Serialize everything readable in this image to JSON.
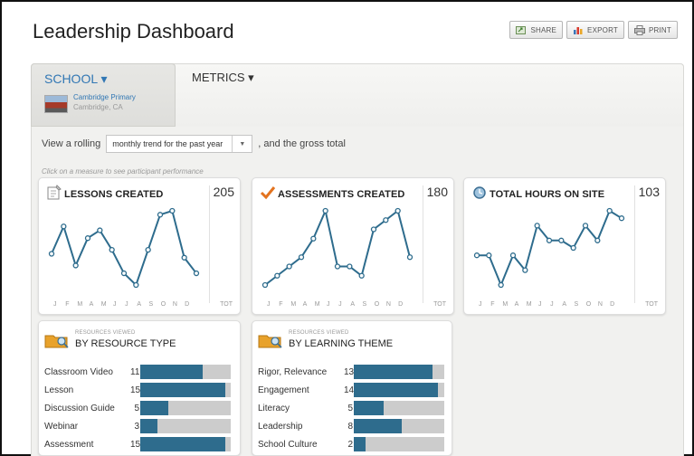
{
  "page": {
    "title": "Leadership Dashboard"
  },
  "actions": [
    {
      "label": "SHARE",
      "icon": "share-icon"
    },
    {
      "label": "EXPORT",
      "icon": "export-icon"
    },
    {
      "label": "PRINT",
      "icon": "print-icon"
    }
  ],
  "school": {
    "label": "SCHOOL ▾",
    "name": "Cambridge Primary",
    "location": "Cambridge, CA"
  },
  "metrics": {
    "label": "METRICS ▾"
  },
  "rolling": {
    "prefix": "View a rolling",
    "select_value": "monthly trend for the past year",
    "suffix": ", and the gross total"
  },
  "hint": "Click on a measure to see participant performance",
  "accent": "#2e6c8d",
  "months": [
    "J",
    "F",
    "M",
    "A",
    "M",
    "J",
    "J",
    "A",
    "S",
    "O",
    "N",
    "D"
  ],
  "tot_label": "TOT",
  "cards": [
    {
      "title": "LESSONS CREATED",
      "total": "205",
      "icon": "lessons-icon",
      "values": [
        9,
        16,
        6,
        13,
        15,
        10,
        4,
        1,
        10,
        19,
        20,
        8,
        4
      ]
    },
    {
      "title": "ASSESSMENTS CREATED",
      "total": "180",
      "icon": "checkmark-icon",
      "values": [
        5,
        6,
        7,
        8,
        10,
        13,
        7,
        7,
        6,
        11,
        12,
        13,
        8
      ]
    },
    {
      "title": "TOTAL HOURS ON SITE",
      "total": "103",
      "icon": "clock-icon",
      "values": [
        7,
        7,
        5,
        7,
        6,
        9,
        8,
        8,
        7.5,
        9,
        8,
        10,
        9.5
      ]
    }
  ],
  "resources_type": {
    "sub": "RESOURCES VIEWED",
    "title": "BY RESOURCE TYPE",
    "max": 16,
    "rows": [
      {
        "label": "Classroom Video",
        "value": 11
      },
      {
        "label": "Lesson",
        "value": 15
      },
      {
        "label": "Discussion Guide",
        "value": 5
      },
      {
        "label": "Webinar",
        "value": 3
      },
      {
        "label": "Assessment",
        "value": 15
      }
    ]
  },
  "resources_theme": {
    "sub": "RESOURCES VIEWED",
    "title": "BY LEARNING THEME",
    "max": 15,
    "rows": [
      {
        "label": "Rigor, Relevance",
        "value": 13
      },
      {
        "label": "Engagement",
        "value": 14
      },
      {
        "label": "Literacy",
        "value": 5
      },
      {
        "label": "Leadership",
        "value": 8
      },
      {
        "label": "School Culture",
        "value": 2
      }
    ]
  }
}
